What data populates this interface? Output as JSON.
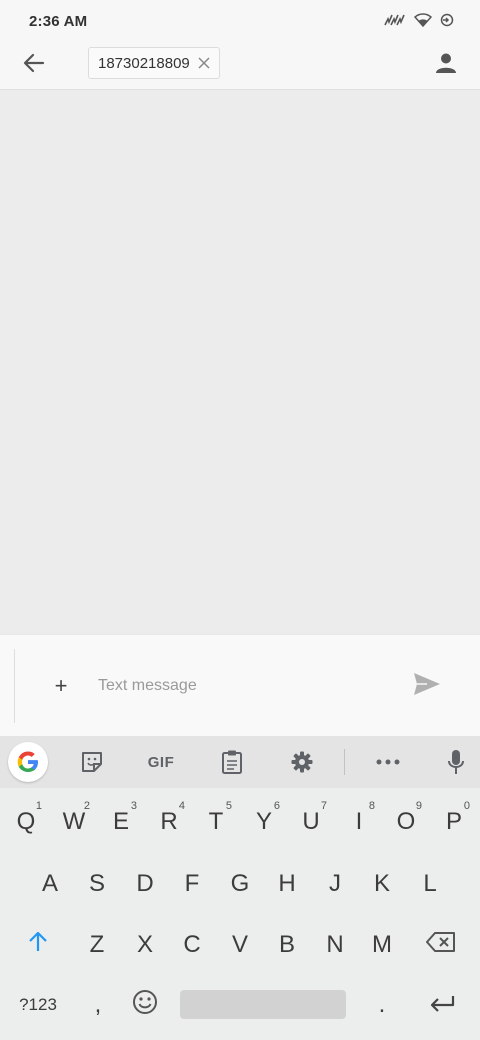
{
  "status_bar": {
    "time": "2:36 AM",
    "icons": [
      "signal-icon",
      "wifi-icon",
      "battery-saver-icon"
    ]
  },
  "header": {
    "recipient": "18730218809"
  },
  "compose": {
    "attach_label": "+",
    "placeholder": "Text message"
  },
  "keyboard": {
    "toolbar": {
      "gif_label": "GIF"
    },
    "row1": [
      {
        "label": "Q",
        "hint": "1"
      },
      {
        "label": "W",
        "hint": "2"
      },
      {
        "label": "E",
        "hint": "3"
      },
      {
        "label": "R",
        "hint": "4"
      },
      {
        "label": "T",
        "hint": "5"
      },
      {
        "label": "Y",
        "hint": "6"
      },
      {
        "label": "U",
        "hint": "7"
      },
      {
        "label": "I",
        "hint": "8"
      },
      {
        "label": "O",
        "hint": "9"
      },
      {
        "label": "P",
        "hint": "0"
      }
    ],
    "row2": [
      "A",
      "S",
      "D",
      "F",
      "G",
      "H",
      "J",
      "K",
      "L"
    ],
    "row3": [
      "Z",
      "X",
      "C",
      "V",
      "B",
      "N",
      "M"
    ],
    "bottom": {
      "symbols_label": "?123",
      "comma_label": ",",
      "period_label": "."
    }
  },
  "colors": {
    "accent": "#1a73e8",
    "shift_active": "#2196f3"
  }
}
